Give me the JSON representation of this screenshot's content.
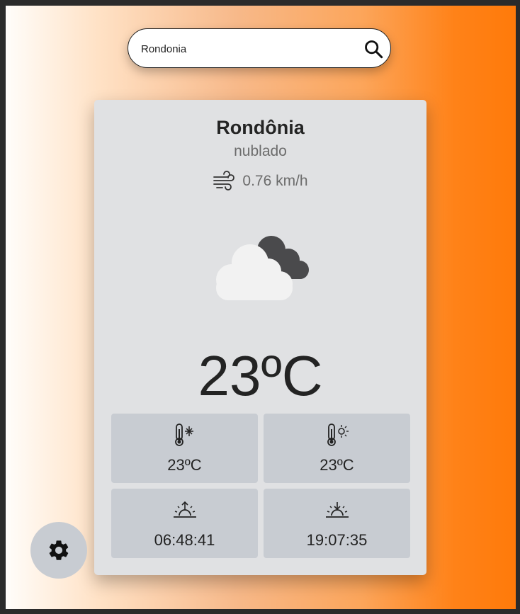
{
  "search": {
    "value": "Rondonia",
    "icon": "search-icon"
  },
  "weather": {
    "city": "Rondônia",
    "condition": "nublado",
    "wind": "0.76 km/h",
    "temperature": "23ºC",
    "icon": "cloudy-icon"
  },
  "tiles": [
    {
      "icon": "thermometer-cold-icon",
      "value": "23ºC"
    },
    {
      "icon": "thermometer-hot-icon",
      "value": "23ºC"
    },
    {
      "icon": "sunrise-icon",
      "value": "06:48:41"
    },
    {
      "icon": "sunset-icon",
      "value": "19:07:35"
    }
  ],
  "settings": {
    "icon": "gear-icon"
  },
  "colors": {
    "gradient_start": "#fffdfa",
    "gradient_end": "#ff7a0a",
    "card": "#e0e1e3",
    "tile": "#c8ccd2"
  }
}
